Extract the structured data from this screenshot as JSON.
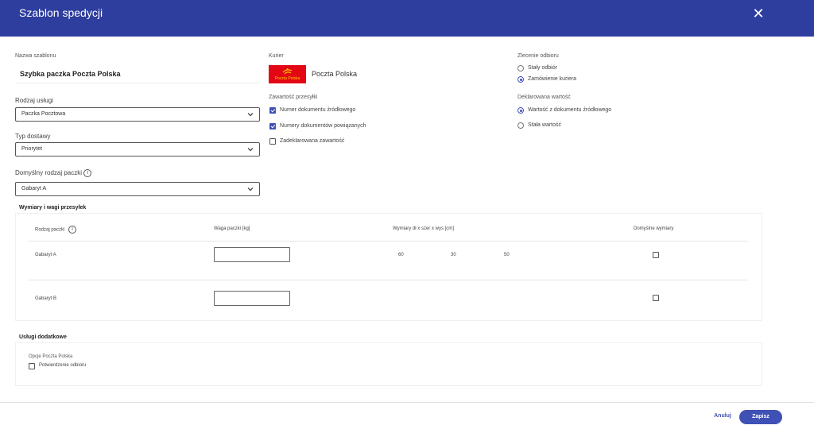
{
  "header": {
    "title": "Szablon spedycji",
    "close_icon": "close-icon"
  },
  "form": {
    "template_name_label": "Nazwa szablonu",
    "template_name_value": "Szybka paczka Poczta Polska",
    "service_type_label": "Rodzaj usługi",
    "service_type_value": "Paczka Pocztowa",
    "delivery_type_label": "Typ dostawy",
    "delivery_type_value": "Priorytet",
    "default_package_label": "Domyślny rodzaj paczki",
    "default_package_value": "Gabaryt A"
  },
  "courier": {
    "label": "Kurier",
    "logo_text": "Poczta Polska",
    "name": "Poczta Polska"
  },
  "contents": {
    "label": "Zawartość przesyłki",
    "options": [
      {
        "label": "Numer dokumentu źródłowego",
        "checked": true
      },
      {
        "label": "Numery dokumentów powiązanych",
        "checked": true
      },
      {
        "label": "Zadeklarowana zawartość",
        "checked": false
      }
    ]
  },
  "pickup": {
    "label": "Zlecenie odbioru",
    "options": [
      {
        "label": "Stały odbiór",
        "checked": false
      },
      {
        "label": "Zamówienie kuriera",
        "checked": true
      }
    ]
  },
  "declared": {
    "label": "Deklarowana wartość",
    "options": [
      {
        "label": "Wartość z dokumentu źródłowego",
        "checked": true
      },
      {
        "label": "Stała wartość",
        "checked": false
      }
    ]
  },
  "dimensions": {
    "section_title": "Wymiary i wagi przesyłek",
    "headers": {
      "package_type": "Rodzaj paczki",
      "weight": "Waga paczki [kg]",
      "dims": "Wymiary dł x szer x wys [cm]",
      "default_dims": "Domyślne wymiary"
    },
    "rows": [
      {
        "name": "Gabaryt A",
        "weight": "",
        "length": "60",
        "width": "30",
        "height": "50",
        "default": false
      },
      {
        "name": "Gabaryt B",
        "weight": "",
        "length": "",
        "width": "",
        "height": "",
        "default": false
      }
    ]
  },
  "extra": {
    "section_title": "Usługi dodatkowe",
    "group_label": "Opcje Poczta Polska",
    "options": [
      {
        "label": "Potwierdzenie odbioru",
        "checked": false
      }
    ]
  },
  "footer": {
    "cancel_label": "Anuluj",
    "save_label": "Zapisz"
  },
  "colors": {
    "header_bg": "#2e3e9e",
    "accent": "#3f51b5",
    "logo_red": "#e30613",
    "logo_yellow": "#ffcc00"
  }
}
